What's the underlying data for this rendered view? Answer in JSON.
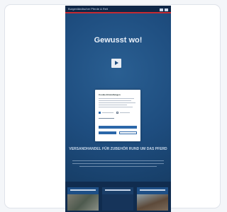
{
  "phone": {
    "status_title": "Burgenländischer Pferde & Reit",
    "headline": "Gewusst wo!",
    "subheadline": "VERSANDHANDEL FÜR ZUBEHÖR RUND UM DAS PFERD",
    "play_label": "Play video"
  },
  "cookie_dialog": {
    "title": "Cookie-Einstellungen",
    "checkbox_necessary_label": "Notwendige",
    "checkbox_statistics_label": "Statistik",
    "accept_all_label": "Alle akzeptieren",
    "save_label": "Speichern",
    "decline_label": "Ablehnen"
  },
  "colors": {
    "brand_blue": "#1e4d7f",
    "accent_red": "#c52a32",
    "button_blue": "#2b67a9"
  },
  "icons": [
    "play-icon",
    "signal-icon",
    "battery-icon"
  ]
}
